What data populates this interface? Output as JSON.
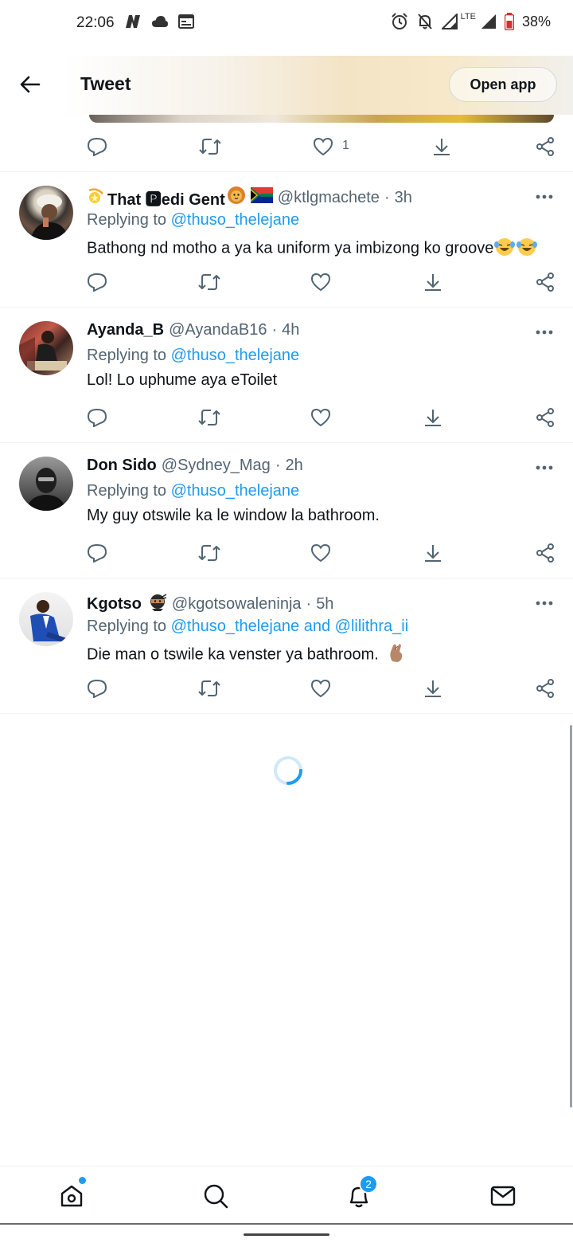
{
  "status_bar": {
    "time": "22:06",
    "battery": "38%",
    "network": "LTE"
  },
  "header": {
    "title": "Tweet",
    "open_app_label": "Open app"
  },
  "top_actions": {
    "like_count": "1"
  },
  "tweets": [
    {
      "name": "That 🅿edi Gent",
      "handle": "@ktlgmachete",
      "time": "3h",
      "reply_prefix": "Replying to",
      "reply_to": "@thuso_thelejane",
      "text": "Bathong nd motho a ya ka uniform ya imbizong ko groove"
    },
    {
      "name": "Ayanda_B",
      "handle": "@AyandaB16",
      "time": "4h",
      "reply_prefix": "Replying to",
      "reply_to": "@thuso_thelejane",
      "text": "Lol! Lo uphume aya eToilet"
    },
    {
      "name": "Don Sido",
      "handle": "@Sydney_Mag",
      "time": "2h",
      "reply_prefix": "Replying to",
      "reply_to": "@thuso_thelejane",
      "text": "My guy otswile ka le window la bathroom."
    },
    {
      "name": "Kgotso",
      "handle": "@kgotsowaleninja",
      "time": "5h",
      "reply_prefix": "Replying to",
      "reply_to": "@thuso_thelejane and @lilithra_ii",
      "text": "Die man o tswile ka venster ya bathroom."
    }
  ],
  "bottom_nav": {
    "notifications_badge": "2"
  },
  "colors": {
    "accent": "#1d9bf0",
    "secondary_text": "#536471",
    "primary_text": "#0f1419",
    "divider": "#eff3f4"
  },
  "icons": [
    "back-arrow-icon",
    "reply-icon",
    "retweet-icon",
    "heart-icon",
    "download-icon",
    "share-icon",
    "more-icon",
    "home-icon",
    "search-icon",
    "bell-icon",
    "mail-icon"
  ]
}
